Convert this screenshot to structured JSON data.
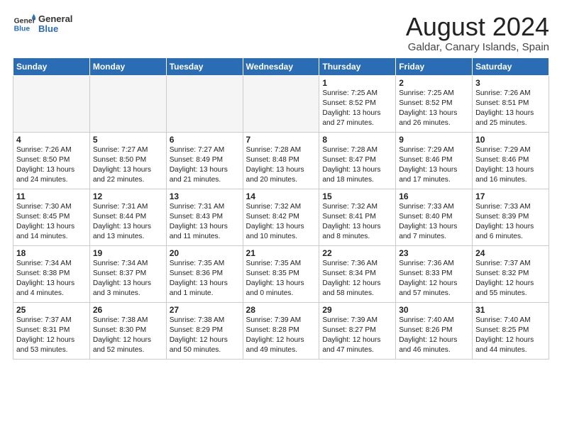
{
  "header": {
    "logo_general": "General",
    "logo_blue": "Blue",
    "month_title": "August 2024",
    "location": "Galdar, Canary Islands, Spain"
  },
  "weekdays": [
    "Sunday",
    "Monday",
    "Tuesday",
    "Wednesday",
    "Thursday",
    "Friday",
    "Saturday"
  ],
  "weeks": [
    [
      {
        "day": "",
        "info": ""
      },
      {
        "day": "",
        "info": ""
      },
      {
        "day": "",
        "info": ""
      },
      {
        "day": "",
        "info": ""
      },
      {
        "day": "1",
        "info": "Sunrise: 7:25 AM\nSunset: 8:52 PM\nDaylight: 13 hours\nand 27 minutes."
      },
      {
        "day": "2",
        "info": "Sunrise: 7:25 AM\nSunset: 8:52 PM\nDaylight: 13 hours\nand 26 minutes."
      },
      {
        "day": "3",
        "info": "Sunrise: 7:26 AM\nSunset: 8:51 PM\nDaylight: 13 hours\nand 25 minutes."
      }
    ],
    [
      {
        "day": "4",
        "info": "Sunrise: 7:26 AM\nSunset: 8:50 PM\nDaylight: 13 hours\nand 24 minutes."
      },
      {
        "day": "5",
        "info": "Sunrise: 7:27 AM\nSunset: 8:50 PM\nDaylight: 13 hours\nand 22 minutes."
      },
      {
        "day": "6",
        "info": "Sunrise: 7:27 AM\nSunset: 8:49 PM\nDaylight: 13 hours\nand 21 minutes."
      },
      {
        "day": "7",
        "info": "Sunrise: 7:28 AM\nSunset: 8:48 PM\nDaylight: 13 hours\nand 20 minutes."
      },
      {
        "day": "8",
        "info": "Sunrise: 7:28 AM\nSunset: 8:47 PM\nDaylight: 13 hours\nand 18 minutes."
      },
      {
        "day": "9",
        "info": "Sunrise: 7:29 AM\nSunset: 8:46 PM\nDaylight: 13 hours\nand 17 minutes."
      },
      {
        "day": "10",
        "info": "Sunrise: 7:29 AM\nSunset: 8:46 PM\nDaylight: 13 hours\nand 16 minutes."
      }
    ],
    [
      {
        "day": "11",
        "info": "Sunrise: 7:30 AM\nSunset: 8:45 PM\nDaylight: 13 hours\nand 14 minutes."
      },
      {
        "day": "12",
        "info": "Sunrise: 7:31 AM\nSunset: 8:44 PM\nDaylight: 13 hours\nand 13 minutes."
      },
      {
        "day": "13",
        "info": "Sunrise: 7:31 AM\nSunset: 8:43 PM\nDaylight: 13 hours\nand 11 minutes."
      },
      {
        "day": "14",
        "info": "Sunrise: 7:32 AM\nSunset: 8:42 PM\nDaylight: 13 hours\nand 10 minutes."
      },
      {
        "day": "15",
        "info": "Sunrise: 7:32 AM\nSunset: 8:41 PM\nDaylight: 13 hours\nand 8 minutes."
      },
      {
        "day": "16",
        "info": "Sunrise: 7:33 AM\nSunset: 8:40 PM\nDaylight: 13 hours\nand 7 minutes."
      },
      {
        "day": "17",
        "info": "Sunrise: 7:33 AM\nSunset: 8:39 PM\nDaylight: 13 hours\nand 6 minutes."
      }
    ],
    [
      {
        "day": "18",
        "info": "Sunrise: 7:34 AM\nSunset: 8:38 PM\nDaylight: 13 hours\nand 4 minutes."
      },
      {
        "day": "19",
        "info": "Sunrise: 7:34 AM\nSunset: 8:37 PM\nDaylight: 13 hours\nand 3 minutes."
      },
      {
        "day": "20",
        "info": "Sunrise: 7:35 AM\nSunset: 8:36 PM\nDaylight: 13 hours\nand 1 minute."
      },
      {
        "day": "21",
        "info": "Sunrise: 7:35 AM\nSunset: 8:35 PM\nDaylight: 13 hours\nand 0 minutes."
      },
      {
        "day": "22",
        "info": "Sunrise: 7:36 AM\nSunset: 8:34 PM\nDaylight: 12 hours\nand 58 minutes."
      },
      {
        "day": "23",
        "info": "Sunrise: 7:36 AM\nSunset: 8:33 PM\nDaylight: 12 hours\nand 57 minutes."
      },
      {
        "day": "24",
        "info": "Sunrise: 7:37 AM\nSunset: 8:32 PM\nDaylight: 12 hours\nand 55 minutes."
      }
    ],
    [
      {
        "day": "25",
        "info": "Sunrise: 7:37 AM\nSunset: 8:31 PM\nDaylight: 12 hours\nand 53 minutes."
      },
      {
        "day": "26",
        "info": "Sunrise: 7:38 AM\nSunset: 8:30 PM\nDaylight: 12 hours\nand 52 minutes."
      },
      {
        "day": "27",
        "info": "Sunrise: 7:38 AM\nSunset: 8:29 PM\nDaylight: 12 hours\nand 50 minutes."
      },
      {
        "day": "28",
        "info": "Sunrise: 7:39 AM\nSunset: 8:28 PM\nDaylight: 12 hours\nand 49 minutes."
      },
      {
        "day": "29",
        "info": "Sunrise: 7:39 AM\nSunset: 8:27 PM\nDaylight: 12 hours\nand 47 minutes."
      },
      {
        "day": "30",
        "info": "Sunrise: 7:40 AM\nSunset: 8:26 PM\nDaylight: 12 hours\nand 46 minutes."
      },
      {
        "day": "31",
        "info": "Sunrise: 7:40 AM\nSunset: 8:25 PM\nDaylight: 12 hours\nand 44 minutes."
      }
    ]
  ]
}
